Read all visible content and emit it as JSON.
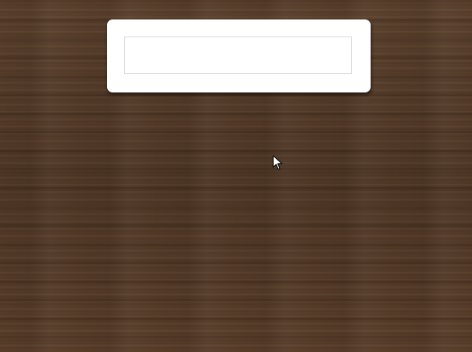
{
  "input": {
    "value": "",
    "placeholder": ""
  },
  "icons": {
    "cursor": "mouse-pointer-icon"
  },
  "colors": {
    "background_wood": "#5a3f2b",
    "card": "#ffffff",
    "input_border": "#dcdcdc"
  }
}
